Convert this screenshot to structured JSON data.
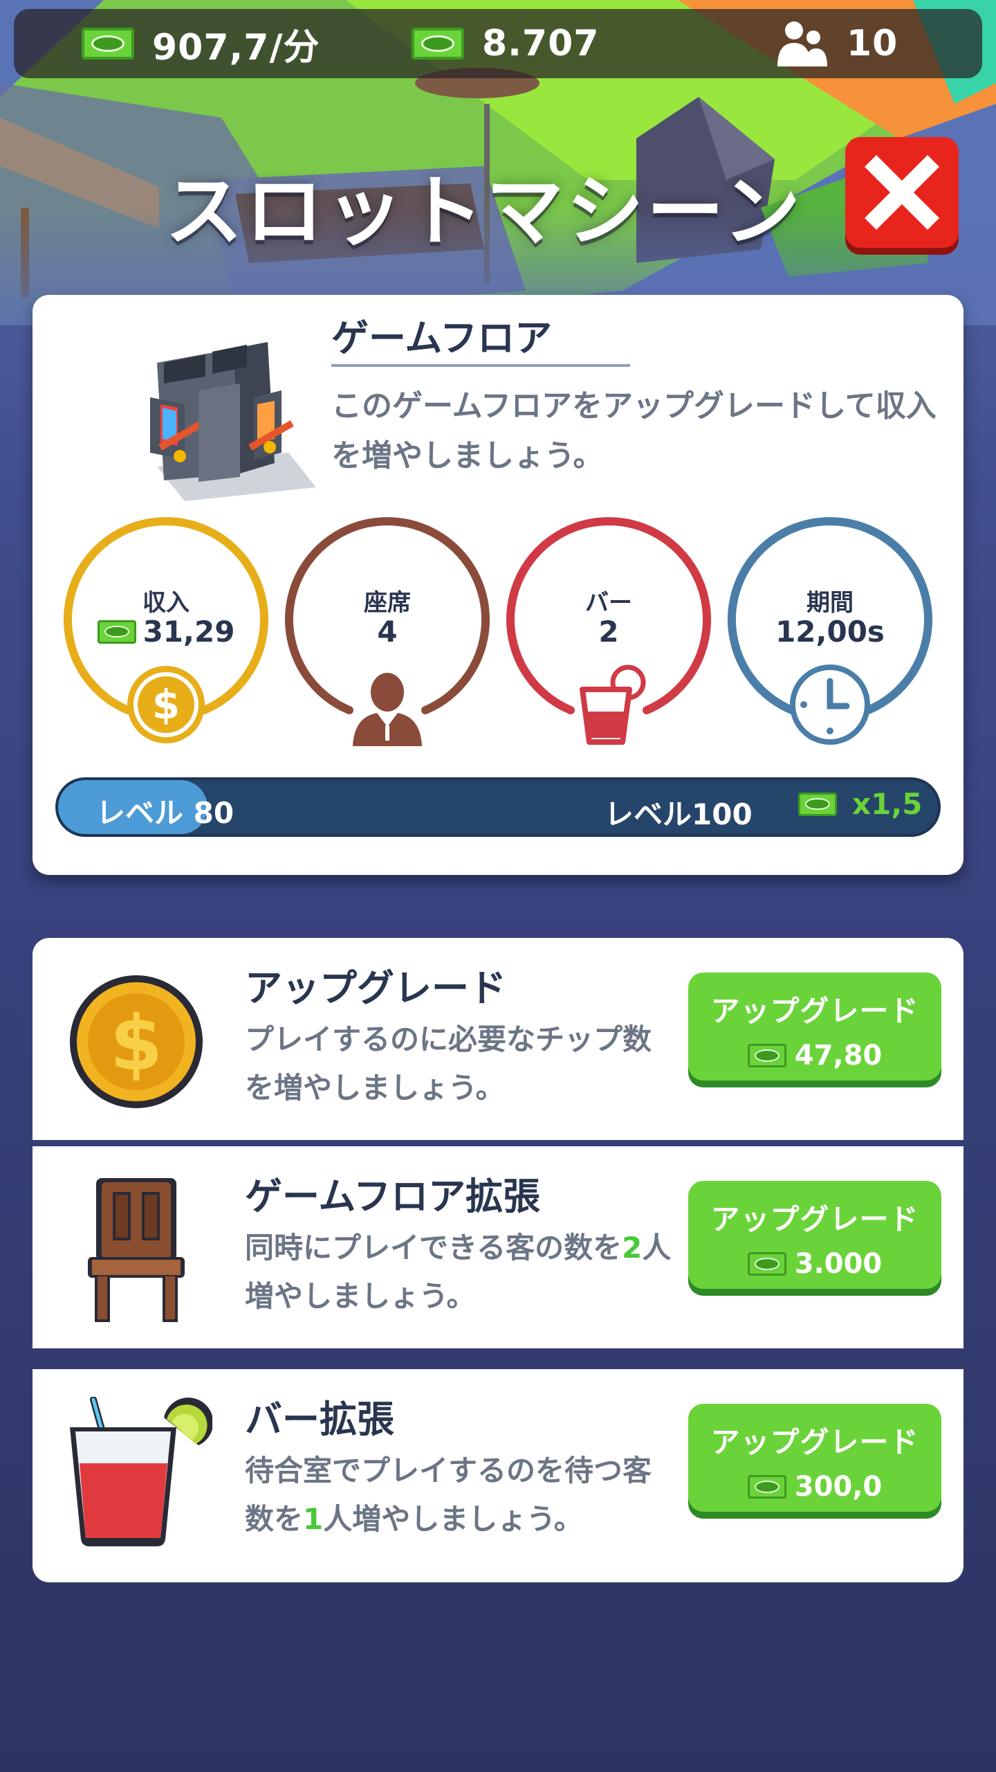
{
  "topbar": {
    "income_rate": "907,7/分",
    "cash": "8.707",
    "visitors": "10",
    "icons": [
      "cash-icon",
      "cash-icon",
      "people-icon"
    ]
  },
  "title": "スロットマシーン",
  "info": {
    "heading": "ゲームフロア",
    "description": "このゲームフロアをアップグレードして収入を増やしましょう。",
    "stats": [
      {
        "label": "収入",
        "value": "31,29",
        "icon": "dollar-coin-icon",
        "color": "#e7ae1a"
      },
      {
        "label": "座席",
        "value": "4",
        "icon": "person-icon",
        "color": "#8b4b3a"
      },
      {
        "label": "バー",
        "value": "2",
        "icon": "drink-icon",
        "color": "#d03a45"
      },
      {
        "label": "期間",
        "value": "12,00s",
        "icon": "clock-icon",
        "color": "#4a7ea8"
      }
    ],
    "level": {
      "current_label": "レベル 80",
      "target_label": "レベル100",
      "bonus": "x1,5",
      "progress": 0.17
    }
  },
  "upgrades": [
    {
      "title": "アップグレード",
      "desc_pre": "プレイするのに必要なチップ数を増やしましょう。",
      "desc_hl": "",
      "desc_post": "",
      "button": "アップグレード",
      "cost": "47,80",
      "icon": "gold-coin-icon"
    },
    {
      "title": "ゲームフロア拡張",
      "desc_pre": "同時にプレイできる客の数を",
      "desc_hl": "2",
      "desc_post": "人増やしましょう。",
      "button": "アップグレード",
      "cost": "3.000",
      "icon": "chair-icon"
    },
    {
      "title": "バー拡張",
      "desc_pre": "待合室でプレイするのを待つ客数を",
      "desc_hl": "1",
      "desc_post": "人増やしましょう。",
      "button": "アップグレード",
      "cost": "300,0",
      "icon": "cocktail-icon"
    }
  ],
  "colors": {
    "accent_green": "#6bd33a",
    "close_red": "#e8251d",
    "navy_text": "#2a3550"
  }
}
